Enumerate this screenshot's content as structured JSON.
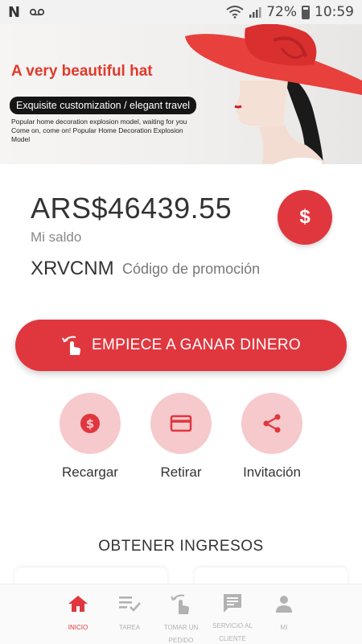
{
  "status_bar": {
    "battery": "72%",
    "time": "10:59"
  },
  "banner": {
    "title": "A very beautiful hat",
    "pill": "Exquisite customization / elegant travel",
    "desc_line1": "Popular home decoration explosion model, waiting for you",
    "desc_line2": "Come on, come on! Popular Home Decoration Explosion Model"
  },
  "balance": {
    "amount": "ARS$46439.55",
    "label": "Mi saldo",
    "dollar_glyph": "$"
  },
  "promo": {
    "code": "XRVCNM",
    "label": "Código de promoción"
  },
  "earn_button": {
    "label": "EMPIECE A GANAR DINERO"
  },
  "actions": [
    {
      "label": "Recargar",
      "icon": "dollar-coin-icon"
    },
    {
      "label": "Retirar",
      "icon": "card-icon"
    },
    {
      "label": "Invitación",
      "icon": "share-icon"
    }
  ],
  "section": {
    "title": "OBTENER INGRESOS"
  },
  "bottom_nav": [
    {
      "label": "INICIO",
      "icon": "home-icon",
      "active": true
    },
    {
      "label": "TAREA",
      "icon": "task-list-icon",
      "active": false
    },
    {
      "label": "TOMAR UN PEDIDO",
      "icon": "tap-hand-icon",
      "active": false
    },
    {
      "label": "SERVICIO AL CLIENTE",
      "icon": "chat-icon",
      "active": false
    },
    {
      "label": "MI",
      "icon": "person-icon",
      "active": false
    }
  ],
  "colors": {
    "accent": "#e0373f",
    "accent_light": "#f6c9cc",
    "nav_inactive": "#b2b2b2"
  }
}
